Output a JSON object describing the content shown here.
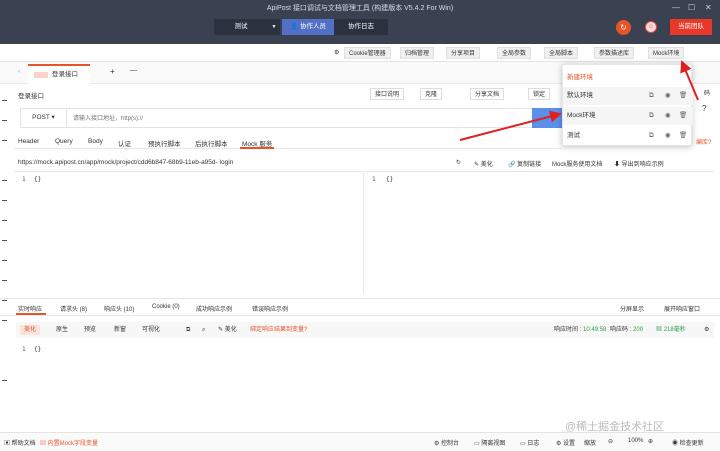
{
  "titlebar": {
    "title": "ApiPost 接口调试与文档管理工具 (构建版本 V5.4.2 For Win)",
    "min": "—",
    "max": "☐",
    "close": "✕",
    "segment": {
      "env": "测试",
      "collab": "协作人员",
      "log": "协作日志"
    },
    "team_button": "当前团队"
  },
  "toolbar": {
    "cookie": "Cookie管理器",
    "archive": "归档管理",
    "share_project": "分享项目",
    "global_params": "全局参数",
    "global_script": "全局脚本",
    "param_desc": "参数描述库",
    "mock_env": "Mock环境"
  },
  "tabs": {
    "active": "登录接口",
    "add": "+",
    "more": "—"
  },
  "api": {
    "name": "登录接口",
    "doc_btn": "接口说明",
    "clone_btn": "克隆",
    "share_btn": "分享文档",
    "lock_btn": "锁定",
    "code_btn": "码",
    "method": "POST",
    "url_placeholder": "请输入接口地址，http(s)://"
  },
  "subtabs": [
    "Header",
    "Query",
    "Body",
    "认证",
    "预执行脚本",
    "后执行脚本",
    "Mock 服务"
  ],
  "mock": {
    "url": "https://mock.apipost.cn/app/mock/project/cdd6b847-68b9-11eb-a95d-",
    "url_suffix": "login",
    "beautify": "美化",
    "copy_link": "复制链接",
    "doc": "Mock服务使用文档",
    "import": "导出到响应示例",
    "left_code": "{}",
    "right_code": "{}",
    "line": "1"
  },
  "response": {
    "tabs": [
      "实时响应",
      "请求头 (8)",
      "响应头 (10)",
      "Cookie (0)",
      "成功响应示例",
      "错误响应示例"
    ],
    "split": "分屏显示",
    "expand": "展开响应窗口",
    "formats": [
      "美化",
      "原生",
      "预览",
      "新窗",
      "可视化"
    ],
    "beautify": "美化",
    "tip": "绑定响应结果到变量?",
    "resp_time_label": "响应时间 : ",
    "resp_time": "10:49:58",
    "status_label": "响应码 : ",
    "status": "200",
    "duration": "218毫秒",
    "body": "{}",
    "line": "1"
  },
  "env_dropdown": {
    "new": "新建环境",
    "items": [
      "默认环境",
      "Mock环境",
      "测试"
    ],
    "side_label": "",
    "edge_text": "编库?"
  },
  "statusbar": {
    "help": "帮助文档",
    "mock_vars": "内置Mock字段变量",
    "console": "控制台",
    "layout": "隔离视图",
    "log": "日志",
    "settings": "设置",
    "zoom_label": "缩放",
    "zoom": "100%",
    "check": "检查更新"
  },
  "watermark": "@稀土掘金技术社区",
  "colors": {
    "accent": "#e8542a",
    "blue": "#5470c6",
    "titlebar": "#3a4252",
    "arrow": "#e02020"
  }
}
